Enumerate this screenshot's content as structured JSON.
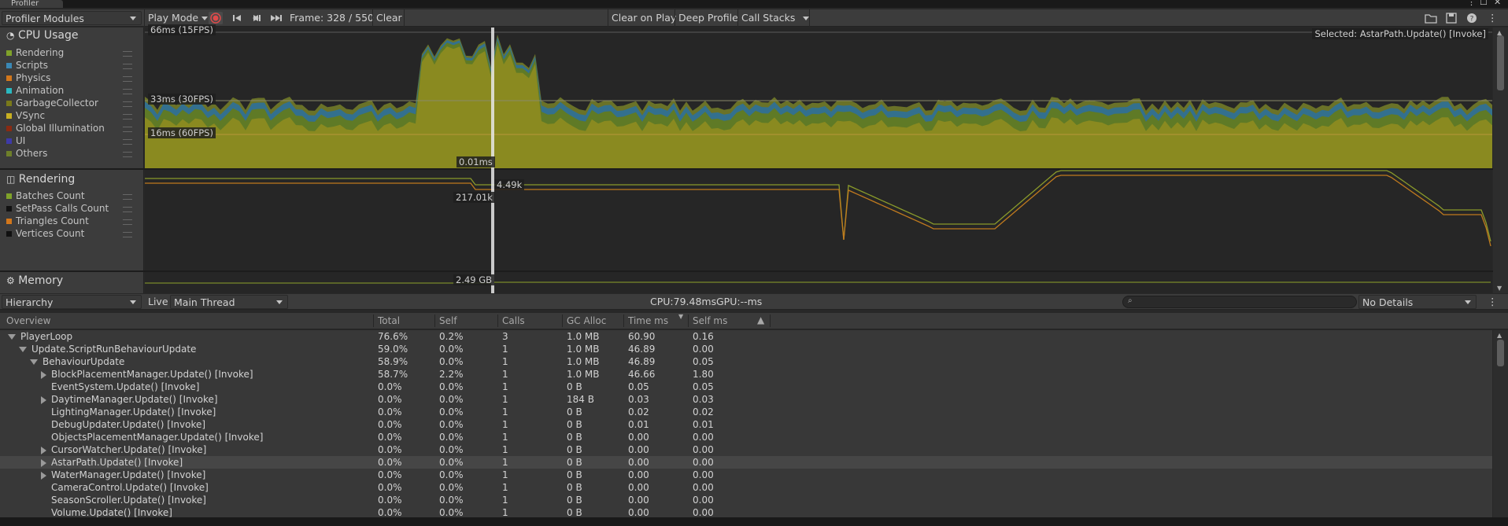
{
  "window": {
    "title": "Profiler"
  },
  "toolbar": {
    "modules_label": "Profiler Modules",
    "mode_label": "Play Mode",
    "frame_label": "Frame: 328 / 550",
    "clear_label": "Clear",
    "clear_on_play_label": "Clear on Play",
    "deep_profile_label": "Deep Profile",
    "call_stacks_label": "Call Stacks"
  },
  "cpu": {
    "title": "CPU Usage",
    "legend": [
      {
        "label": "Rendering",
        "color": "#7fa22a"
      },
      {
        "label": "Scripts",
        "color": "#3a88b5"
      },
      {
        "label": "Physics",
        "color": "#d2771b"
      },
      {
        "label": "Animation",
        "color": "#2ab8c0"
      },
      {
        "label": "GarbageCollector",
        "color": "#7a7a1a"
      },
      {
        "label": "VSync",
        "color": "#c8b022"
      },
      {
        "label": "Global Illumination",
        "color": "#8a2a12"
      },
      {
        "label": "UI",
        "color": "#3e3aa8"
      },
      {
        "label": "Others",
        "color": "#6e7f2a"
      }
    ],
    "fps66": "66ms (15FPS)",
    "fps33": "33ms (30FPS)",
    "fps16": "16ms (60FPS)",
    "cursor_value": "0.01ms",
    "selected": "Selected: AstarPath.Update() [Invoke]"
  },
  "rendering": {
    "title": "Rendering",
    "legend": [
      {
        "label": "Batches Count",
        "color": "#7fa22a"
      },
      {
        "label": "SetPass Calls Count",
        "color": "#111111"
      },
      {
        "label": "Triangles Count",
        "color": "#d2771b"
      },
      {
        "label": "Vertices Count",
        "color": "#111111"
      }
    ],
    "value1": "4.49k",
    "value2": "217.01k"
  },
  "memory": {
    "title": "Memory",
    "value": "2.49 GB"
  },
  "hierarchy": {
    "view_label": "Hierarchy",
    "live_label": "Live",
    "thread_label": "Main Thread",
    "cpu_label": "CPU:79.48ms",
    "gpu_label": "GPU:--ms",
    "search_placeholder": "",
    "details_label": "No Details"
  },
  "columns": [
    "Overview",
    "Total",
    "Self",
    "Calls",
    "GC Alloc",
    "Time ms",
    "Self ms"
  ],
  "rows": [
    {
      "name": "PlayerLoop",
      "indent": 0,
      "expander": "open",
      "total": "76.6%",
      "self": "0.2%",
      "calls": "3",
      "gc": "1.0 MB",
      "time": "60.90",
      "selfms": "0.16"
    },
    {
      "name": "Update.ScriptRunBehaviourUpdate",
      "indent": 1,
      "expander": "open",
      "total": "59.0%",
      "self": "0.0%",
      "calls": "1",
      "gc": "1.0 MB",
      "time": "46.89",
      "selfms": "0.00"
    },
    {
      "name": "BehaviourUpdate",
      "indent": 2,
      "expander": "open",
      "total": "58.9%",
      "self": "0.0%",
      "calls": "1",
      "gc": "1.0 MB",
      "time": "46.89",
      "selfms": "0.05"
    },
    {
      "name": "BlockPlacementManager.Update() [Invoke]",
      "indent": 3,
      "expander": "closed",
      "total": "58.7%",
      "self": "2.2%",
      "calls": "1",
      "gc": "1.0 MB",
      "time": "46.66",
      "selfms": "1.80"
    },
    {
      "name": "EventSystem.Update() [Invoke]",
      "indent": 3,
      "expander": "none",
      "total": "0.0%",
      "self": "0.0%",
      "calls": "1",
      "gc": "0 B",
      "time": "0.05",
      "selfms": "0.05"
    },
    {
      "name": "DaytimeManager.Update() [Invoke]",
      "indent": 3,
      "expander": "closed",
      "total": "0.0%",
      "self": "0.0%",
      "calls": "1",
      "gc": "184 B",
      "time": "0.03",
      "selfms": "0.03"
    },
    {
      "name": "LightingManager.Update() [Invoke]",
      "indent": 3,
      "expander": "none",
      "total": "0.0%",
      "self": "0.0%",
      "calls": "1",
      "gc": "0 B",
      "time": "0.02",
      "selfms": "0.02"
    },
    {
      "name": "DebugUpdater.Update() [Invoke]",
      "indent": 3,
      "expander": "none",
      "total": "0.0%",
      "self": "0.0%",
      "calls": "1",
      "gc": "0 B",
      "time": "0.01",
      "selfms": "0.01"
    },
    {
      "name": "ObjectsPlacementManager.Update() [Invoke]",
      "indent": 3,
      "expander": "none",
      "total": "0.0%",
      "self": "0.0%",
      "calls": "1",
      "gc": "0 B",
      "time": "0.00",
      "selfms": "0.00"
    },
    {
      "name": "CursorWatcher.Update() [Invoke]",
      "indent": 3,
      "expander": "closed",
      "total": "0.0%",
      "self": "0.0%",
      "calls": "1",
      "gc": "0 B",
      "time": "0.00",
      "selfms": "0.00"
    },
    {
      "name": "AstarPath.Update() [Invoke]",
      "indent": 3,
      "expander": "closed",
      "total": "0.0%",
      "self": "0.0%",
      "calls": "1",
      "gc": "0 B",
      "time": "0.00",
      "selfms": "0.00",
      "selected": true
    },
    {
      "name": "WaterManager.Update() [Invoke]",
      "indent": 3,
      "expander": "closed",
      "total": "0.0%",
      "self": "0.0%",
      "calls": "1",
      "gc": "0 B",
      "time": "0.00",
      "selfms": "0.00"
    },
    {
      "name": "CameraControl.Update() [Invoke]",
      "indent": 3,
      "expander": "none",
      "total": "0.0%",
      "self": "0.0%",
      "calls": "1",
      "gc": "0 B",
      "time": "0.00",
      "selfms": "0.00"
    },
    {
      "name": "SeasonScroller.Update() [Invoke]",
      "indent": 3,
      "expander": "none",
      "total": "0.0%",
      "self": "0.0%",
      "calls": "1",
      "gc": "0 B",
      "time": "0.00",
      "selfms": "0.00"
    },
    {
      "name": "Volume.Update() [Invoke]",
      "indent": 3,
      "expander": "none",
      "total": "0.0%",
      "self": "0.0%",
      "calls": "1",
      "gc": "0 B",
      "time": "0.00",
      "selfms": "0.00"
    }
  ]
}
